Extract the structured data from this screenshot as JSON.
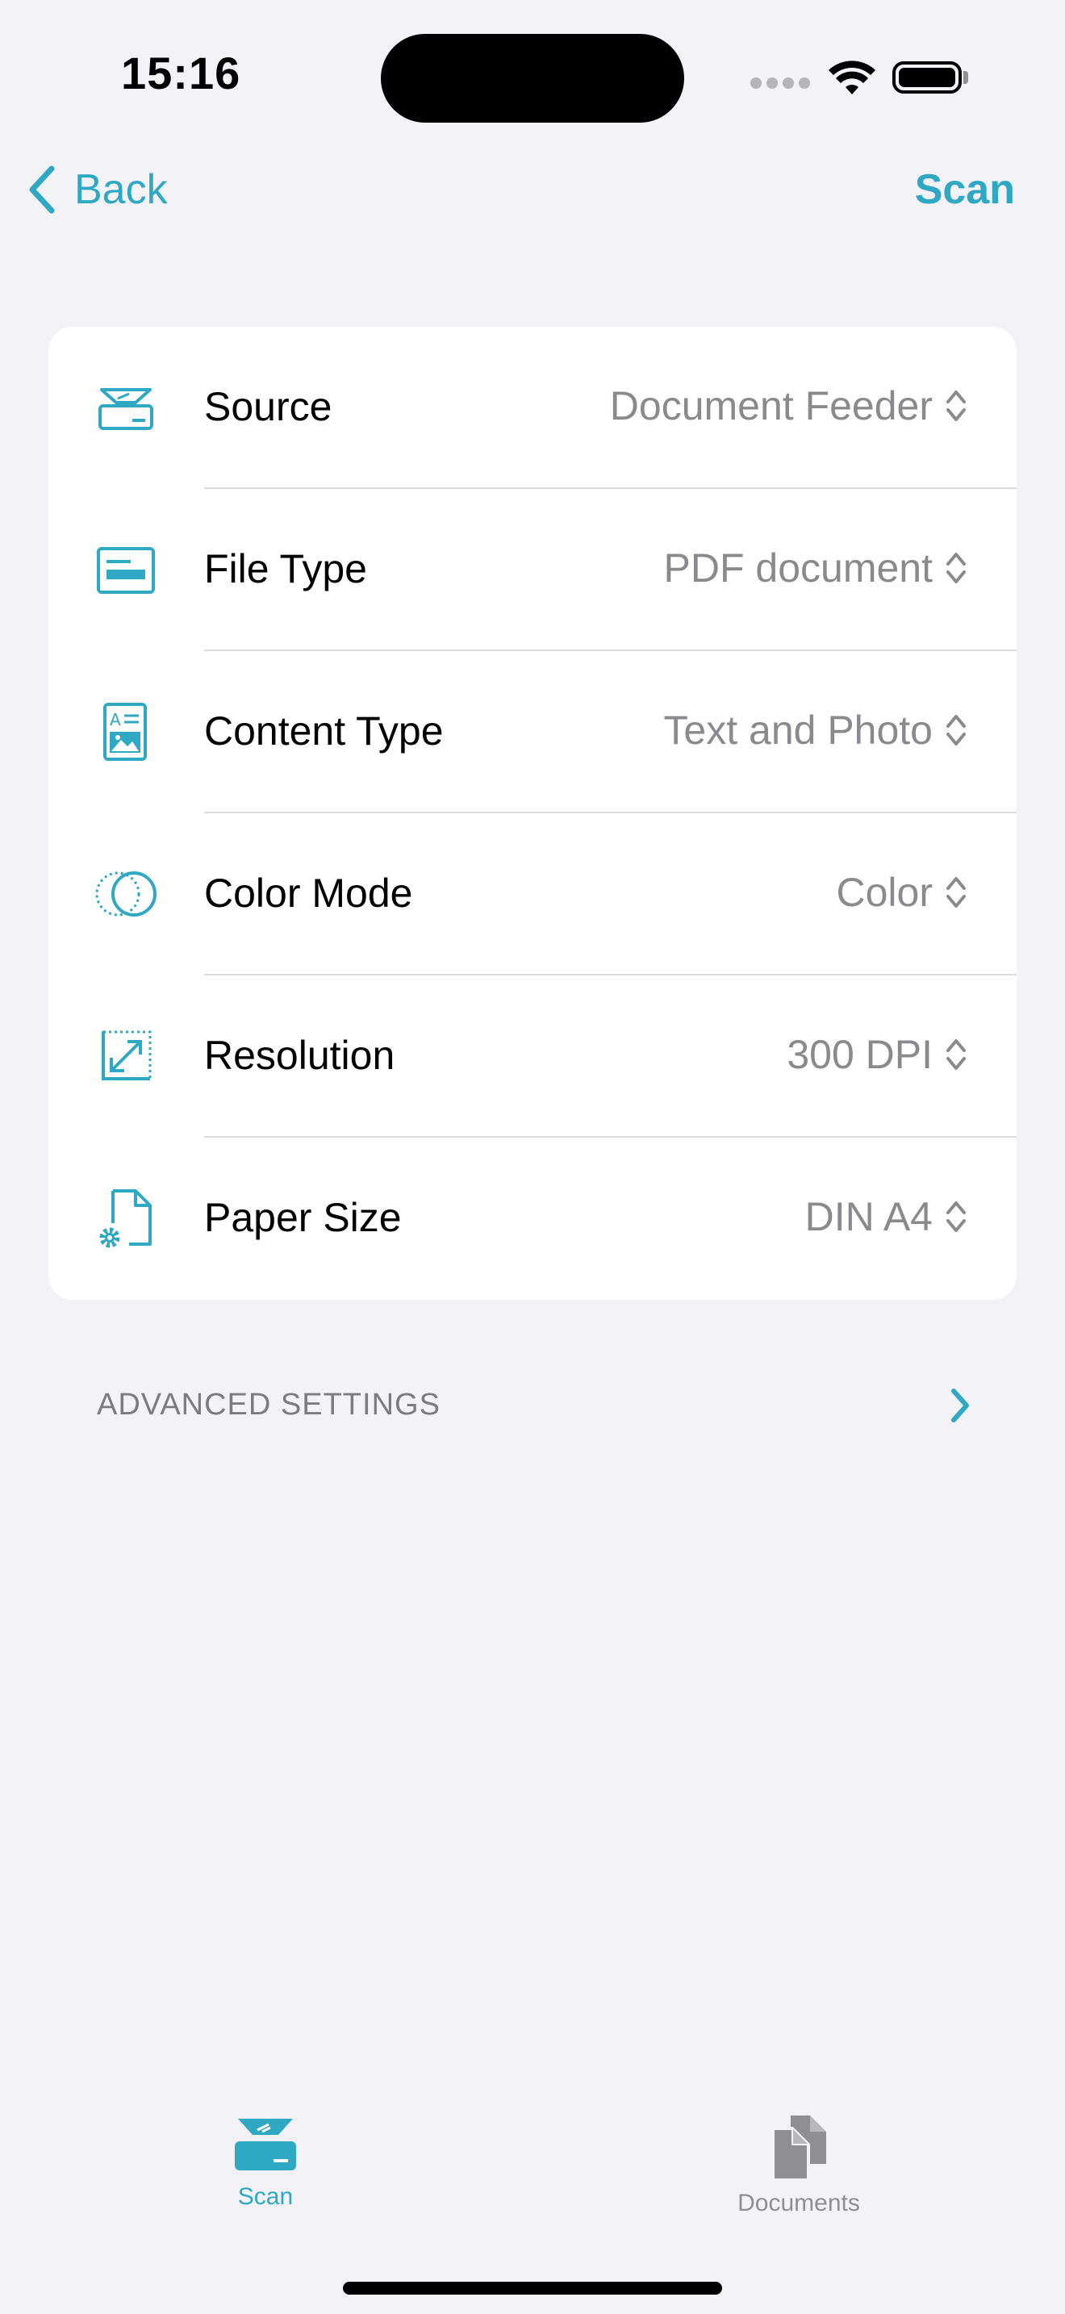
{
  "status_bar": {
    "time": "15:16"
  },
  "nav": {
    "back_label": "Back",
    "scan_label": "Scan"
  },
  "settings": [
    {
      "label": "Source",
      "value": "Document Feeder",
      "icon": "scanner-icon"
    },
    {
      "label": "File Type",
      "value": "PDF document",
      "icon": "file-type-icon"
    },
    {
      "label": "Content Type",
      "value": "Text and Photo",
      "icon": "content-type-icon"
    },
    {
      "label": "Color Mode",
      "value": "Color",
      "icon": "color-mode-icon"
    },
    {
      "label": "Resolution",
      "value": "300 DPI",
      "icon": "resolution-icon"
    },
    {
      "label": "Paper Size",
      "value": "DIN A4",
      "icon": "paper-size-icon"
    }
  ],
  "advanced": {
    "label": "ADVANCED SETTINGS"
  },
  "tabs": [
    {
      "label": "Scan",
      "icon": "scanner-tab-icon",
      "selected": true
    },
    {
      "label": "Documents",
      "icon": "documents-tab-icon",
      "selected": false
    }
  ],
  "colors": {
    "accent": "#2fa8c4",
    "background": "#f2f2f7",
    "secondary_text": "#8a8a8e"
  }
}
